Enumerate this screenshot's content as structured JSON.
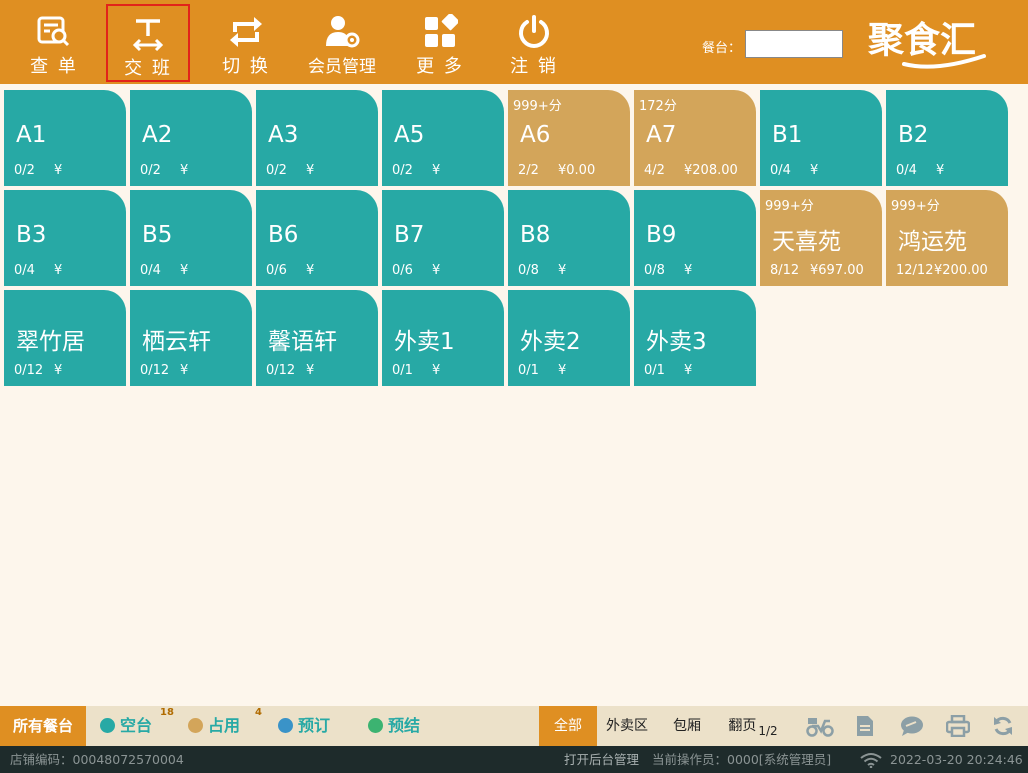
{
  "toolbar": {
    "items": [
      {
        "label": "查 单",
        "icon": "search-receipt-icon"
      },
      {
        "label": "交 班",
        "icon": "shift-handover-icon"
      },
      {
        "label": "切 换",
        "icon": "switch-arrows-icon"
      },
      {
        "label": "会员管理",
        "icon": "member-gear-icon"
      },
      {
        "label": "更 多",
        "icon": "more-grid-icon"
      },
      {
        "label": "注 销",
        "icon": "power-icon"
      }
    ],
    "selected_index": 1,
    "seat_label": "餐台：",
    "seat_input_value": "",
    "brand": "聚食汇"
  },
  "tables": [
    {
      "name": "A1",
      "people": "0/2",
      "amount": "¥",
      "score": "",
      "status": "free"
    },
    {
      "name": "A2",
      "people": "0/2",
      "amount": "¥",
      "score": "",
      "status": "free"
    },
    {
      "name": "A3",
      "people": "0/2",
      "amount": "¥",
      "score": "",
      "status": "free"
    },
    {
      "name": "A5",
      "people": "0/2",
      "amount": "¥",
      "score": "",
      "status": "free"
    },
    {
      "name": "A6",
      "people": "2/2",
      "amount": "¥0.00",
      "score": "999+分",
      "status": "busy"
    },
    {
      "name": "A7",
      "people": "4/2",
      "amount": "¥208.00",
      "score": "172分",
      "status": "busy"
    },
    {
      "name": "B1",
      "people": "0/4",
      "amount": "¥",
      "score": "",
      "status": "free"
    },
    {
      "name": "B2",
      "people": "0/4",
      "amount": "¥",
      "score": "",
      "status": "free"
    },
    {
      "name": "B3",
      "people": "0/4",
      "amount": "¥",
      "score": "",
      "status": "free"
    },
    {
      "name": "B5",
      "people": "0/4",
      "amount": "¥",
      "score": "",
      "status": "free"
    },
    {
      "name": "B6",
      "people": "0/6",
      "amount": "¥",
      "score": "",
      "status": "free"
    },
    {
      "name": "B7",
      "people": "0/6",
      "amount": "¥",
      "score": "",
      "status": "free"
    },
    {
      "name": "B8",
      "people": "0/8",
      "amount": "¥",
      "score": "",
      "status": "free"
    },
    {
      "name": "B9",
      "people": "0/8",
      "amount": "¥",
      "score": "",
      "status": "free"
    },
    {
      "name": "天喜苑",
      "people": "8/12",
      "amount": "¥697.00",
      "score": "999+分",
      "status": "busy"
    },
    {
      "name": "鸿运苑",
      "people": "12/12",
      "amount": "¥200.00",
      "score": "999+分",
      "status": "busy"
    },
    {
      "name": "翠竹居",
      "people": "0/12",
      "amount": "¥",
      "score": "",
      "status": "free"
    },
    {
      "name": "栖云轩",
      "people": "0/12",
      "amount": "¥",
      "score": "",
      "status": "free"
    },
    {
      "name": "馨语轩",
      "people": "0/12",
      "amount": "¥",
      "score": "",
      "status": "free"
    },
    {
      "name": "外卖1",
      "people": "0/1",
      "amount": "¥",
      "score": "",
      "status": "free"
    },
    {
      "name": "外卖2",
      "people": "0/1",
      "amount": "¥",
      "score": "",
      "status": "free"
    },
    {
      "name": "外卖3",
      "people": "0/1",
      "amount": "¥",
      "score": "",
      "status": "free"
    }
  ],
  "statusbar": {
    "all_tables": "所有餐台",
    "legend": [
      {
        "label": "空台",
        "count": "18",
        "color": "#27a9a5"
      },
      {
        "label": "占用",
        "count": "4",
        "color": "#d3a55a"
      },
      {
        "label": "预订",
        "count": "",
        "color": "#3a93c8"
      },
      {
        "label": "预结",
        "count": "",
        "color": "#3cb371"
      }
    ],
    "filters": [
      "全部",
      "外卖区",
      "包厢"
    ],
    "active_filter": 0,
    "pager_label": "翻页",
    "pager_value": "1/2",
    "icons": [
      "delivery-scooter-icon",
      "document-icon",
      "chat-bubble-icon",
      "printer-icon",
      "refresh-icon"
    ]
  },
  "footer": {
    "store_code": "店铺编码：00048072570004",
    "open_admin": "打开后台管理",
    "operator": "当前操作员：0000[系统管理员]",
    "datetime": "2022-03-20 20:24:46",
    "wifi_icon": "wifi-icon"
  },
  "colors": {
    "accent": "#df8f22",
    "free": "#27a9a5",
    "busy": "#d3a55a",
    "background": "#fdf6ec",
    "footer": "#1e2b2b"
  }
}
